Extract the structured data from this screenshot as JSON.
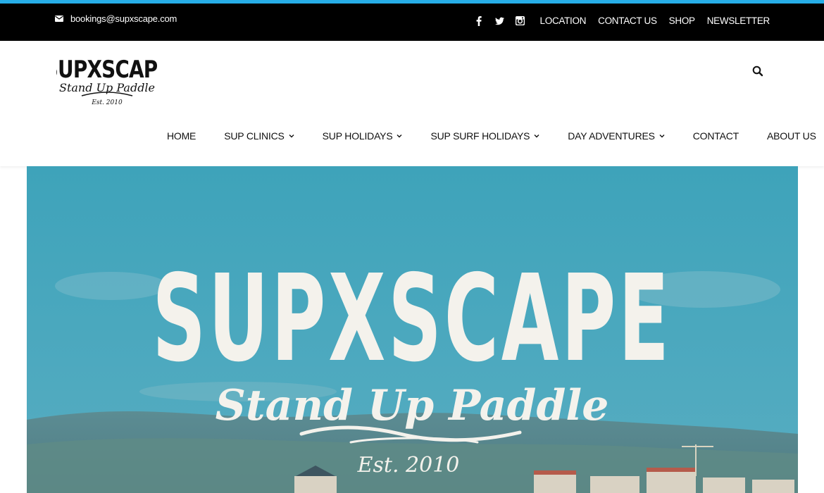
{
  "colors": {
    "accent": "#27aee8",
    "topbar": "#000000",
    "hero_sky": "#4aa5bb"
  },
  "topbar": {
    "email": "bookings@supxscape.com",
    "email_icon": "envelope-icon",
    "social_icons": [
      "facebook-icon",
      "twitter-icon",
      "instagram-icon"
    ],
    "links": [
      "LOCATION",
      "CONTACT US",
      "SHOP",
      "NEWSLETTER"
    ]
  },
  "logo": {
    "line1": "SUPXSCAPE",
    "line2": "Stand Up Paddle",
    "line3": "Est. 2010"
  },
  "search_icon": "search-icon",
  "nav": [
    {
      "label": "HOME",
      "dropdown": false
    },
    {
      "label": "SUP CLINICS",
      "dropdown": true
    },
    {
      "label": "SUP HOLIDAYS",
      "dropdown": true
    },
    {
      "label": "SUP SURF HOLIDAYS",
      "dropdown": true
    },
    {
      "label": "DAY ADVENTURES",
      "dropdown": true
    },
    {
      "label": "CONTACT",
      "dropdown": false
    },
    {
      "label": "ABOUT US",
      "dropdown": false
    }
  ],
  "hero": {
    "title": "SUPXSCAPE",
    "subtitle": "Stand Up Paddle",
    "est": "Est. 2010"
  }
}
